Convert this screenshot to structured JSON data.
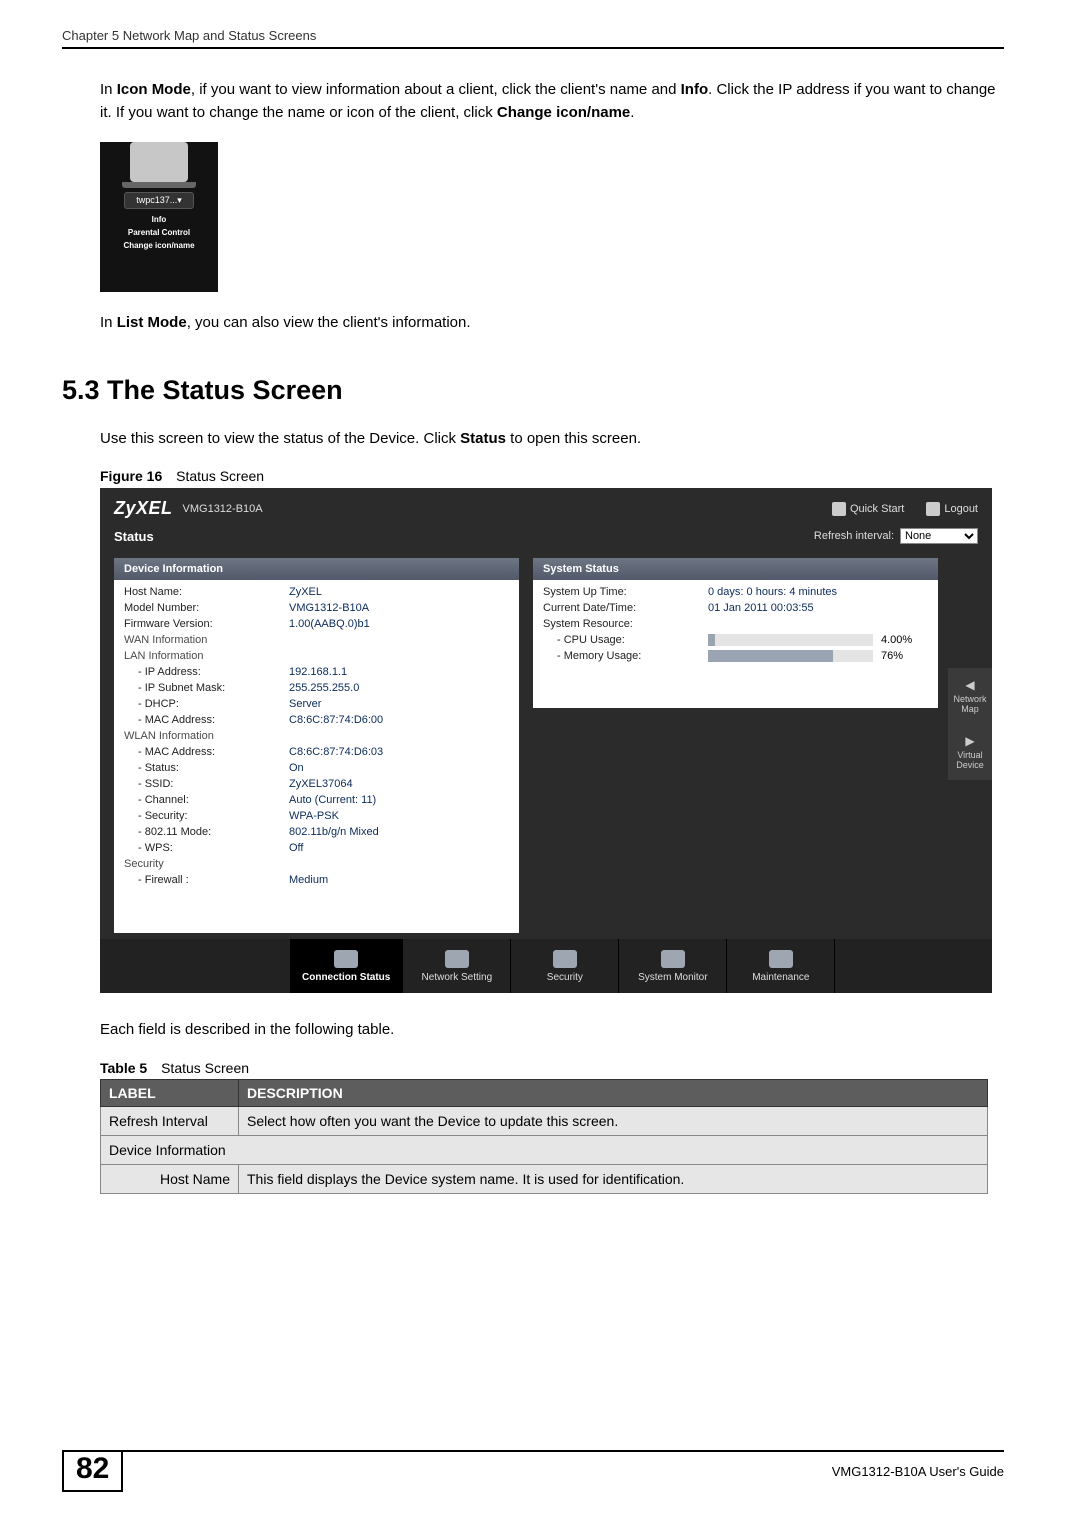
{
  "running_header": "Chapter 5 Network Map and Status Screens",
  "para1_segments": [
    "In ",
    "Icon Mode",
    ", if you want to view information about a client, click the client's name and ",
    "Info",
    ". Click the IP address if you want to change it. If you want to change the name or icon of the client, click ",
    "Change icon/name",
    "."
  ],
  "contextMenu": {
    "clientName": "twpc137...▾",
    "items": [
      "Info",
      "Parental Control",
      "Change icon/name"
    ]
  },
  "para2_segments": [
    "In ",
    "List Mode",
    ", you can also view the client's information."
  ],
  "section_heading": "5.3  The Status Screen",
  "para3_segments": [
    "Use this screen to view the status of the Device. Click ",
    "Status",
    " to open this screen."
  ],
  "figure": {
    "label": "Figure 16",
    "title": "Status Screen"
  },
  "screenshot": {
    "logo": "ZyXEL",
    "model": "VMG1312-B10A",
    "topActions": {
      "quickStart": "Quick Start",
      "logout": "Logout"
    },
    "statusTitle": "Status",
    "refreshLabel": "Refresh interval:",
    "refreshValue": "None",
    "leftPanel": {
      "title": "Device Information",
      "rows": [
        {
          "k": "Host Name:",
          "v": "ZyXEL"
        },
        {
          "k": "Model Number:",
          "v": "VMG1312-B10A"
        },
        {
          "k": "Firmware Version:",
          "v": "1.00(AABQ.0)b1"
        },
        {
          "k": "WAN Information",
          "v": "",
          "group": true
        },
        {
          "k": "LAN Information",
          "v": "",
          "group": true
        },
        {
          "k": "- IP Address:",
          "v": "192.168.1.1",
          "indent": true
        },
        {
          "k": "- IP Subnet Mask:",
          "v": "255.255.255.0",
          "indent": true
        },
        {
          "k": "- DHCP:",
          "v": "Server",
          "indent": true
        },
        {
          "k": "- MAC Address:",
          "v": "C8:6C:87:74:D6:00",
          "indent": true
        },
        {
          "k": "WLAN Information",
          "v": "",
          "group": true
        },
        {
          "k": "- MAC Address:",
          "v": "C8:6C:87:74:D6:03",
          "indent": true
        },
        {
          "k": "- Status:",
          "v": "On",
          "indent": true
        },
        {
          "k": "- SSID:",
          "v": "ZyXEL37064",
          "indent": true
        },
        {
          "k": "- Channel:",
          "v": "Auto (Current: 11)",
          "indent": true
        },
        {
          "k": "- Security:",
          "v": "WPA-PSK",
          "indent": true
        },
        {
          "k": "- 802.11 Mode:",
          "v": "802.11b/g/n Mixed",
          "indent": true
        },
        {
          "k": "- WPS:",
          "v": "Off",
          "indent": true
        },
        {
          "k": "Security",
          "v": "",
          "group": true
        },
        {
          "k": "- Firewall :",
          "v": "Medium",
          "indent": true
        }
      ]
    },
    "rightPanel": {
      "title": "System Status",
      "rows": [
        {
          "k": "System Up Time:",
          "v": "0 days: 0 hours: 4 minutes"
        },
        {
          "k": "Current Date/Time:",
          "v": "01 Jan 2011 00:03:55"
        },
        {
          "k": "System Resource:",
          "v": ""
        },
        {
          "k": "- CPU Usage:",
          "bar": 4,
          "pct": "4.00%",
          "indent": true
        },
        {
          "k": "- Memory Usage:",
          "bar": 76,
          "pct": "76%",
          "indent": true
        }
      ]
    },
    "sideTabs": {
      "networkMap": "Network Map",
      "virtualDevice": "Virtual Device"
    },
    "bottomNav": {
      "items": [
        "Connection Status",
        "Network Setting",
        "Security",
        "System Monitor",
        "Maintenance"
      ],
      "activeIndex": 0
    }
  },
  "para4": "Each field is described in the following table.",
  "table": {
    "label": "Table 5",
    "title": "Status Screen",
    "headers": [
      "LABEL",
      "DESCRIPTION"
    ],
    "rows": [
      {
        "label": "Refresh Interval",
        "desc": "Select how often you want the Device to update this screen.",
        "align": "left"
      },
      {
        "label": "Device Information",
        "desc": "",
        "colspan": true
      },
      {
        "label": "Host Name",
        "desc": "This field displays the Device system name. It is used for identification.",
        "align": "right"
      }
    ]
  },
  "footer": {
    "pageNumber": "82",
    "guide": "VMG1312-B10A User's Guide"
  }
}
